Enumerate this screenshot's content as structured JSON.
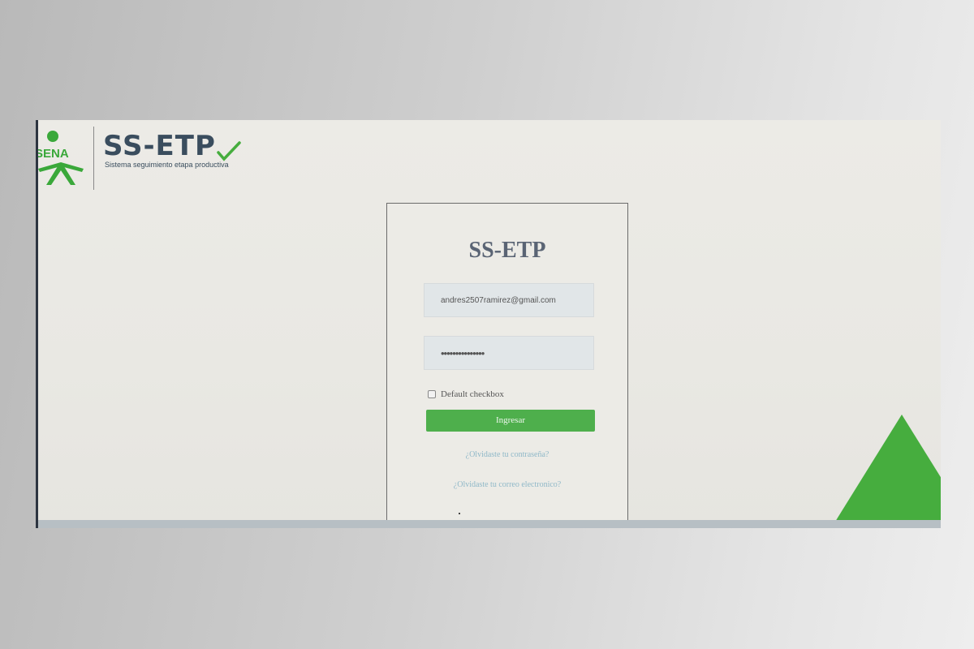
{
  "header": {
    "sena_logo_text": "SENA",
    "brand_title": "SS-ETP",
    "brand_subtitle": "Sistema seguimiento etapa productiva"
  },
  "login": {
    "title": "SS-ETP",
    "email_value": "andres2507ramirez@gmail.com",
    "password_value": "•••••••••••••••",
    "checkbox_label": "Default checkbox",
    "submit_label": "Ingresar",
    "forgot_password_link": "¿Olvidaste tu contraseña?",
    "forgot_email_link": "¿Olvidaste tu correo electronico?"
  },
  "colors": {
    "brand_green": "#46ad3e",
    "button_green": "#4eaf4c",
    "brand_navy": "#3a4d5e",
    "link_blue": "#8fb8c8"
  }
}
